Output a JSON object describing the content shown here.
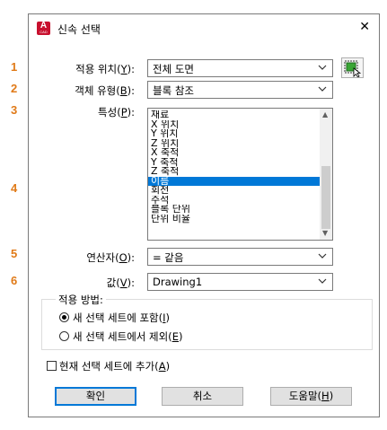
{
  "dialog": {
    "title": "신속 선택",
    "app_icon_letter": "A",
    "app_icon_sub": "CAD",
    "close_glyph": "✕"
  },
  "callouts": [
    "1",
    "2",
    "3",
    "4",
    "5",
    "6"
  ],
  "form": {
    "apply_to": {
      "label_pre": "적용 위치(",
      "key": "Y",
      "label_post": "):",
      "value": "전체 도면"
    },
    "object_type": {
      "label_pre": "객체 유형(",
      "key": "B",
      "label_post": "):",
      "value": "블록 참조"
    },
    "properties": {
      "label_pre": "특성(",
      "key": "P",
      "label_post": "):",
      "items": [
        {
          "text": "재료"
        },
        {
          "text": "X 위치"
        },
        {
          "text": "Y 위치"
        },
        {
          "text": "Z 위치"
        },
        {
          "text": "X 축척"
        },
        {
          "text": "Y 축척"
        },
        {
          "text": "Z 축척"
        },
        {
          "text": "이름"
        },
        {
          "text": "회전"
        },
        {
          "text": "주석"
        },
        {
          "text": "블록 단위"
        },
        {
          "text": "단위 비율"
        }
      ],
      "selected_index": 7
    },
    "operator": {
      "label_pre": "연산자(",
      "key": "O",
      "label_post": "):",
      "value": "= 같음"
    },
    "value": {
      "label_pre": "값(",
      "key": "V",
      "label_post": "):",
      "value": "Drawing1"
    }
  },
  "apply_method": {
    "title": "적용 방법:",
    "include": {
      "label_pre": "새 선택 세트에 포함(",
      "key": "I",
      "label_post": ")",
      "checked": true
    },
    "exclude": {
      "label_pre": "새 선택 세트에서 제외(",
      "key": "E",
      "label_post": ")",
      "checked": false
    }
  },
  "append": {
    "label_pre": "현재 선택 세트에 추가(",
    "key": "A",
    "label_post": ")",
    "checked": false
  },
  "buttons": {
    "ok": "확인",
    "cancel": "취소",
    "help_pre": "도움말(",
    "help_key": "H",
    "help_post": ")"
  },
  "colors": {
    "accent": "#0078d7",
    "callout": "#e07a18",
    "icon": "#c8102e"
  }
}
